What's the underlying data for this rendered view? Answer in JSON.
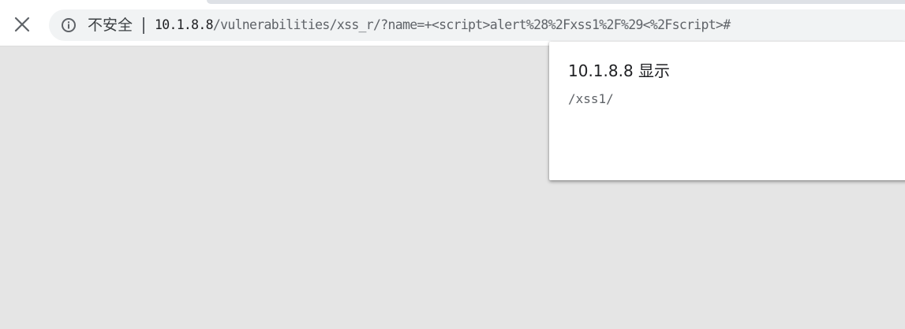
{
  "toolbar": {
    "close_icon": "close-icon",
    "omnibox": {
      "info_icon": "info-icon",
      "security_label": "不安全",
      "url_host": "10.1.8.8",
      "url_path": "/vulnerabilities/xss_r/?name=+<script>alert%28%2Fxss1%2F%29<%2Fscript>#"
    }
  },
  "dialog": {
    "title": "10.1.8.8 显示",
    "message": "/xss1/"
  },
  "colors": {
    "page_background": "#e5e5e5",
    "omnibox_background": "#f1f3f4",
    "dialog_background": "#ffffff"
  }
}
